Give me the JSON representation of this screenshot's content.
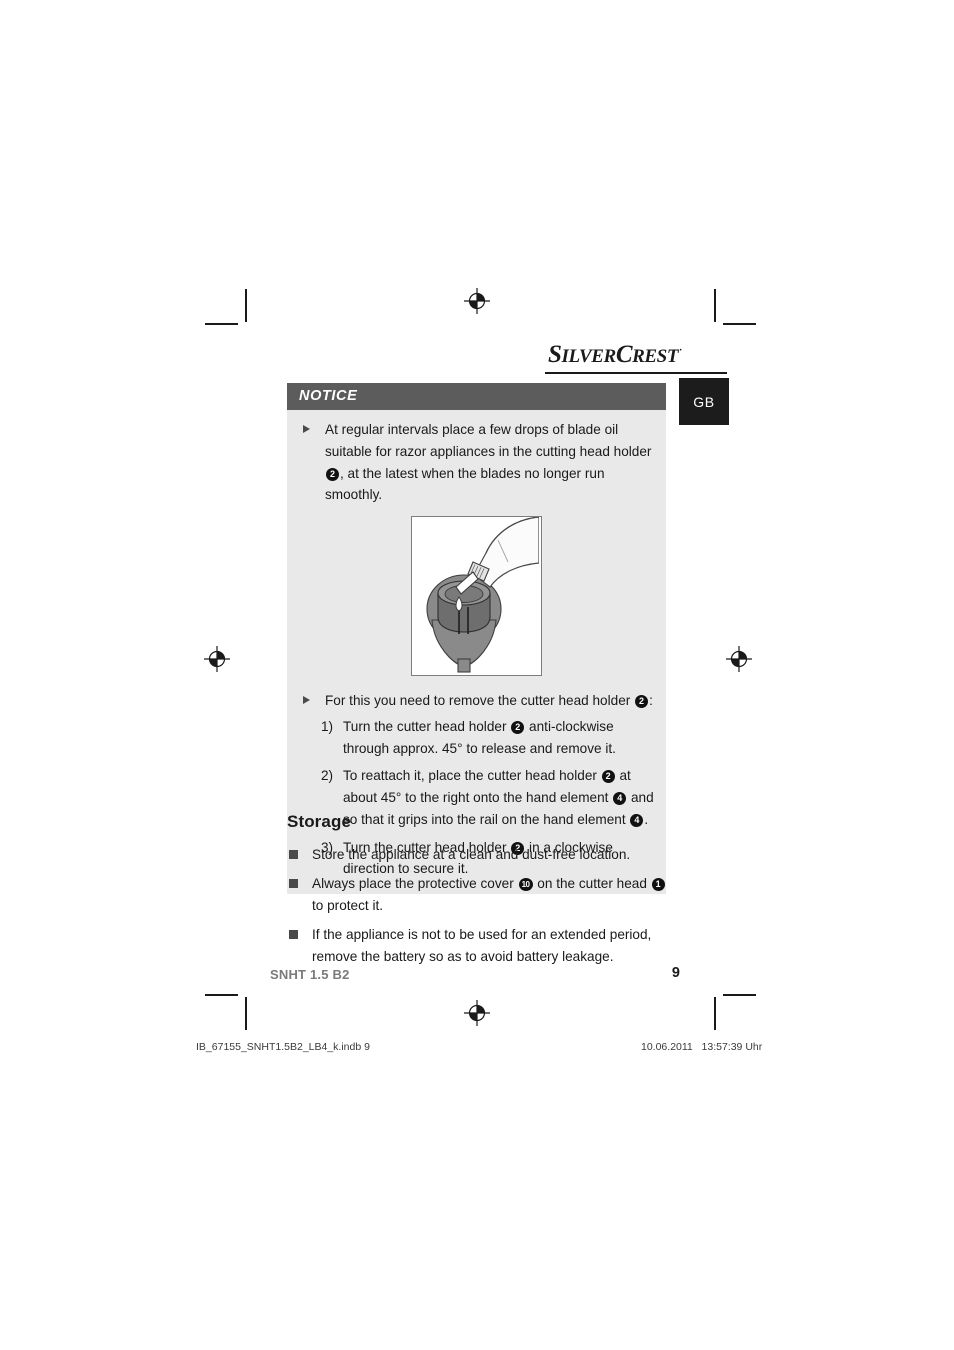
{
  "page": {
    "language_tab": "GB",
    "brand_logo": {
      "part1": "S",
      "part2": "ILVER",
      "part3": "C",
      "part4": "REST",
      "registered": "·"
    }
  },
  "notice": {
    "heading": "NOTICE",
    "bullets": [
      "At regular intervals place a few drops of blade oil suitable for razor appliances in the cutting head holder ❸, at the latest when the blades no longer run smoothly."
    ],
    "bullet1_parts": {
      "a": "At regular intervals place a few drops of blade oil suitable for razor appliances in the cutting head holder ",
      "badge": "2",
      "b": ", at the latest when the blades no longer run smoothly."
    },
    "figure": {
      "name": "oil-application-illustration",
      "description": "Oil bottle dripping blade oil into the cutter head holder"
    },
    "bullet2_parts": {
      "a": "For this you need to remove the cutter head holder ",
      "badge": "2",
      "b": ":"
    },
    "steps": [
      {
        "number": "1)",
        "a": "Turn the cutter head holder ",
        "badge1": "2",
        "b": " anti-clockwise through approx. 45° to release and remove it.",
        "badge2": "",
        "c": ""
      },
      {
        "number": "2)",
        "a": "To reattach it, place the cutter head holder ",
        "badge1": "2",
        "b": " at about 45° to the right onto the hand element ",
        "badge2": "4",
        "c": " and so that it grips into the rail on the hand element ",
        "badge3": "4",
        "d": "."
      },
      {
        "number": "3)",
        "a": "Turn the cutter head holder ",
        "badge1": "2",
        "b": " in a clockwise direction to secure it.",
        "badge2": "",
        "c": ""
      }
    ]
  },
  "storage": {
    "title": "Storage",
    "items": [
      {
        "a": "Store the appliance at a clean and dust-free location.",
        "badge1": "",
        "b": "",
        "badge2": "",
        "c": ""
      },
      {
        "a": "Always place the protective cover ",
        "badge1": "10",
        "b": " on the cutter head ",
        "badge2": "1",
        "c": " to protect it."
      },
      {
        "a": "If the appliance is not to be used for an extended period, remove the battery so as to avoid battery leakage.",
        "badge1": "",
        "b": "",
        "badge2": "",
        "c": ""
      }
    ]
  },
  "footer": {
    "model": "SNHT 1.5 B2",
    "page_number": "9",
    "print_file": "IB_67155_SNHT1.5B2_LB4_k.indb   9",
    "print_timestamp": "10.06.2011   13:57:39 Uhr"
  }
}
